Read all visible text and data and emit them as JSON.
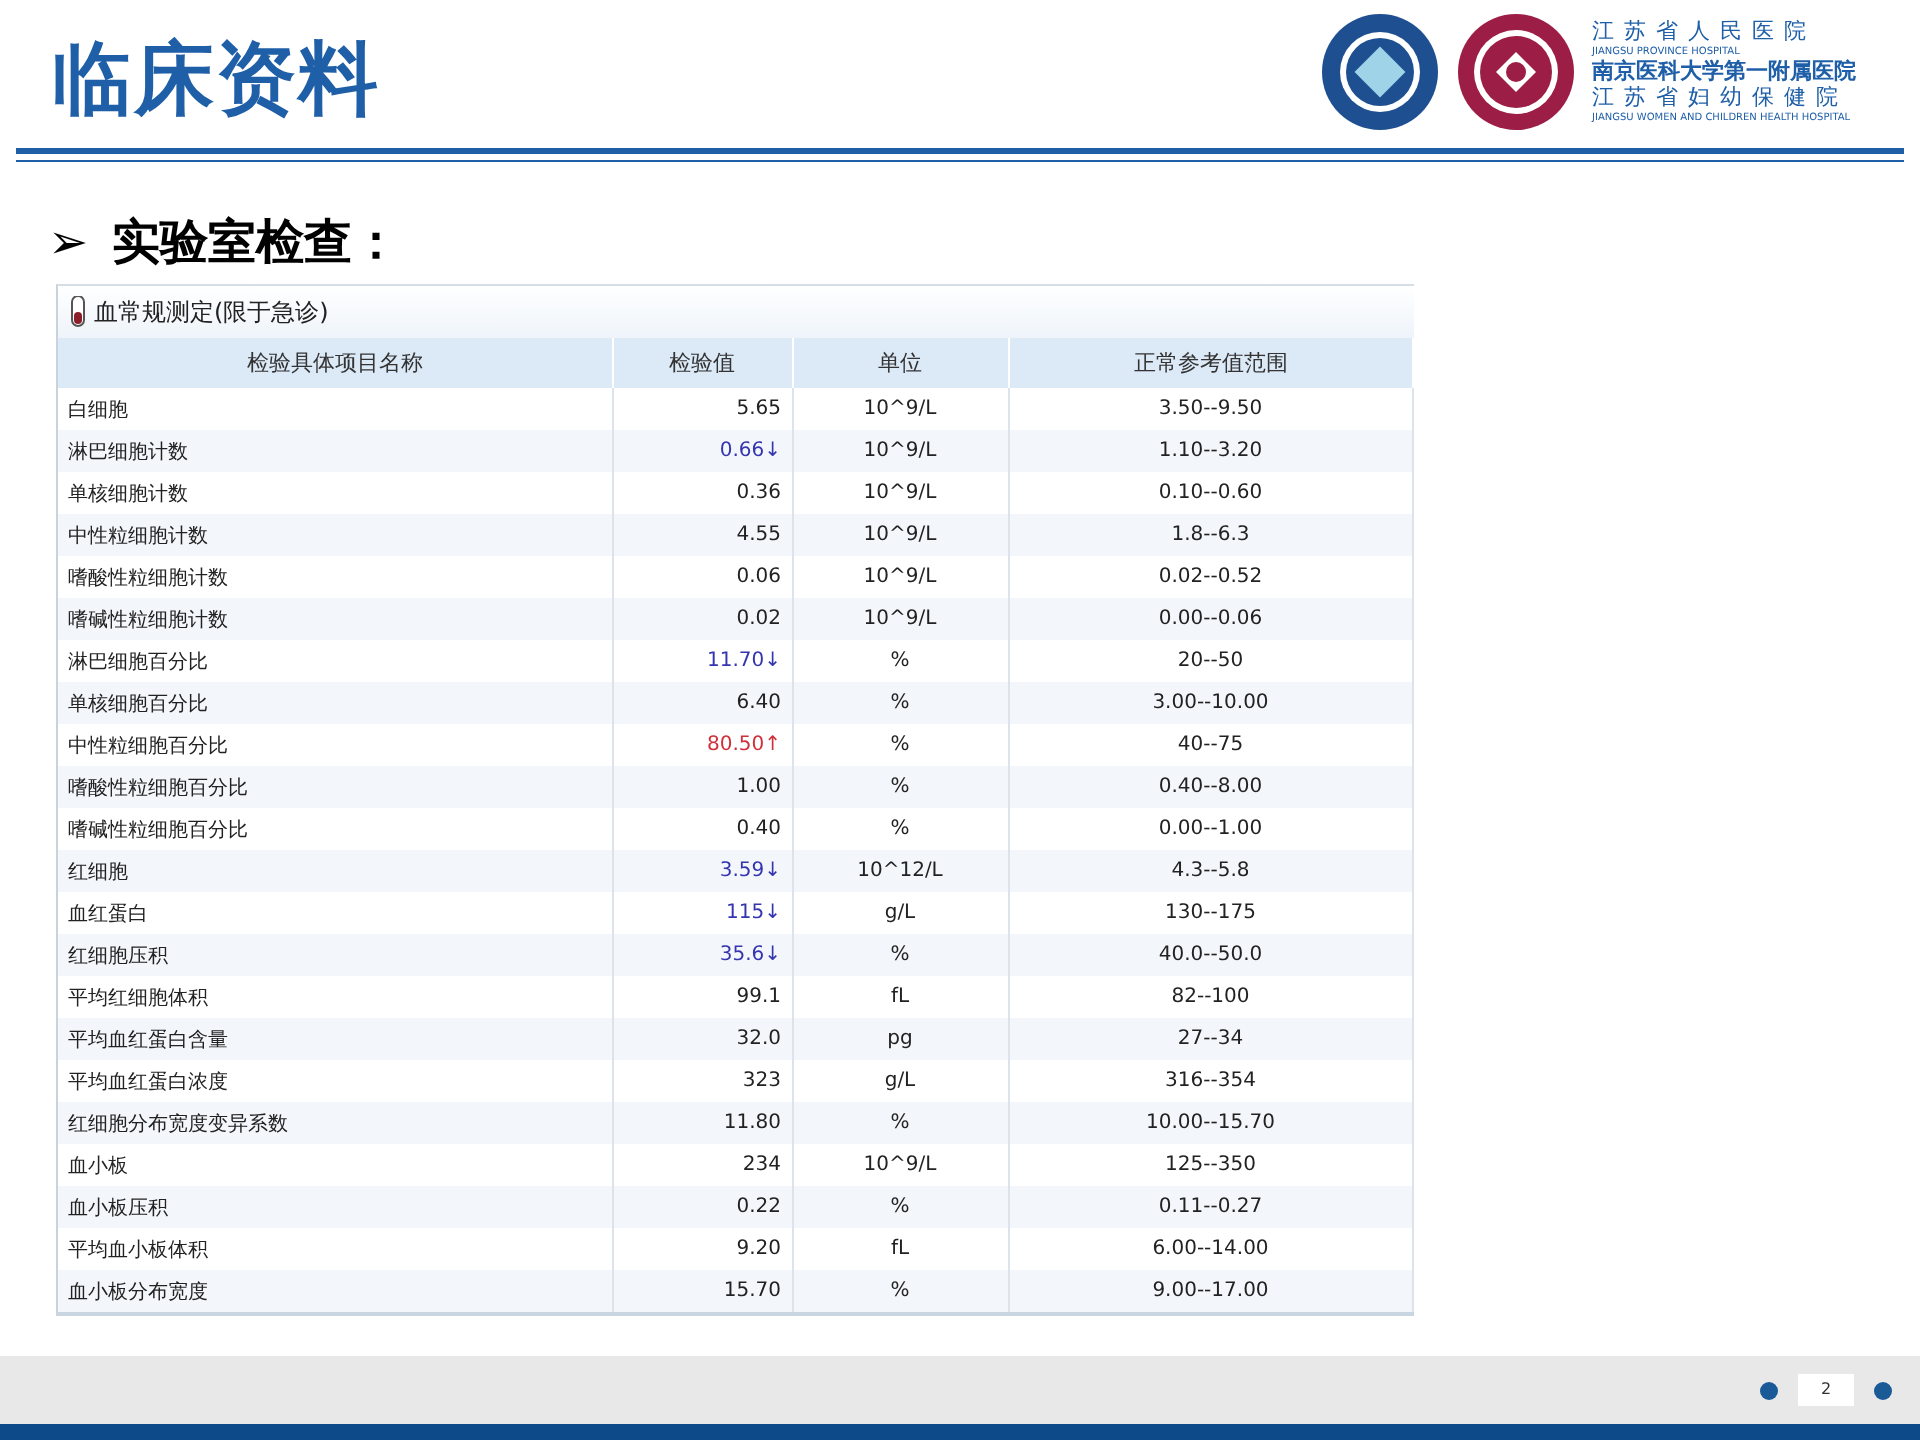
{
  "slide": {
    "title": "临床资料",
    "page_number": "2"
  },
  "logos": {
    "names": [
      {
        "zh": "江苏省人民医院",
        "en": "JIANGSU PROVINCE HOSPITAL"
      },
      {
        "zh": "南京医科大学第一附属医院"
      },
      {
        "zh": "江苏省妇幼保健院",
        "en": "JIANGSU WOMEN AND CHILDREN HEALTH HOSPITAL"
      }
    ]
  },
  "bullet": {
    "marker": "➢",
    "text": "实验室检查："
  },
  "panel": {
    "title": "血常规测定(限于急诊)",
    "columns": [
      "检验具体项目名称",
      "检验值",
      "单位",
      "正常参考值范围"
    ],
    "rows": [
      {
        "name": "白细胞",
        "value": "5.65",
        "color": "#222222",
        "unit": "10^9/L",
        "range": "3.50--9.50"
      },
      {
        "name": "淋巴细胞计数",
        "value": "0.66↓",
        "color": "#3535b0",
        "unit": "10^9/L",
        "range": "1.10--3.20"
      },
      {
        "name": "单核细胞计数",
        "value": "0.36",
        "color": "#222222",
        "unit": "10^9/L",
        "range": "0.10--0.60"
      },
      {
        "name": "中性粒细胞计数",
        "value": "4.55",
        "color": "#222222",
        "unit": "10^9/L",
        "range": "1.8--6.3"
      },
      {
        "name": "嗜酸性粒细胞计数",
        "value": "0.06",
        "color": "#222222",
        "unit": "10^9/L",
        "range": "0.02--0.52"
      },
      {
        "name": "嗜碱性粒细胞计数",
        "value": "0.02",
        "color": "#222222",
        "unit": "10^9/L",
        "range": "0.00--0.06"
      },
      {
        "name": "淋巴细胞百分比",
        "value": "11.70↓",
        "color": "#3535b0",
        "unit": "%",
        "range": "20--50"
      },
      {
        "name": "单核细胞百分比",
        "value": "6.40",
        "color": "#222222",
        "unit": "%",
        "range": "3.00--10.00"
      },
      {
        "name": "中性粒细胞百分比",
        "value": "80.50↑",
        "color": "#d0303a",
        "unit": "%",
        "range": "40--75"
      },
      {
        "name": "嗜酸性粒细胞百分比",
        "value": "1.00",
        "color": "#222222",
        "unit": "%",
        "range": "0.40--8.00"
      },
      {
        "name": "嗜碱性粒细胞百分比",
        "value": "0.40",
        "color": "#222222",
        "unit": "%",
        "range": "0.00--1.00"
      },
      {
        "name": "红细胞",
        "value": "3.59↓",
        "color": "#3535b0",
        "unit": "10^12/L",
        "range": "4.3--5.8"
      },
      {
        "name": "血红蛋白",
        "value": "115↓",
        "color": "#3535b0",
        "unit": "g/L",
        "range": "130--175"
      },
      {
        "name": "红细胞压积",
        "value": "35.6↓",
        "color": "#3535b0",
        "unit": "%",
        "range": "40.0--50.0"
      },
      {
        "name": "平均红细胞体积",
        "value": "99.1",
        "color": "#222222",
        "unit": "fL",
        "range": "82--100"
      },
      {
        "name": "平均血红蛋白含量",
        "value": "32.0",
        "color": "#222222",
        "unit": "pg",
        "range": "27--34"
      },
      {
        "name": "平均血红蛋白浓度",
        "value": "323",
        "color": "#222222",
        "unit": "g/L",
        "range": "316--354"
      },
      {
        "name": "红细胞分布宽度变异系数",
        "value": "11.80",
        "color": "#222222",
        "unit": "%",
        "range": "10.00--15.70"
      },
      {
        "name": "血小板",
        "value": "234",
        "color": "#222222",
        "unit": "10^9/L",
        "range": "125--350"
      },
      {
        "name": "血小板压积",
        "value": "0.22",
        "color": "#222222",
        "unit": "%",
        "range": "0.11--0.27"
      },
      {
        "name": "平均血小板体积",
        "value": "9.20",
        "color": "#222222",
        "unit": "fL",
        "range": "6.00--14.00"
      },
      {
        "name": "血小板分布宽度",
        "value": "15.70",
        "color": "#222222",
        "unit": "%",
        "range": "9.00--17.00"
      }
    ]
  }
}
